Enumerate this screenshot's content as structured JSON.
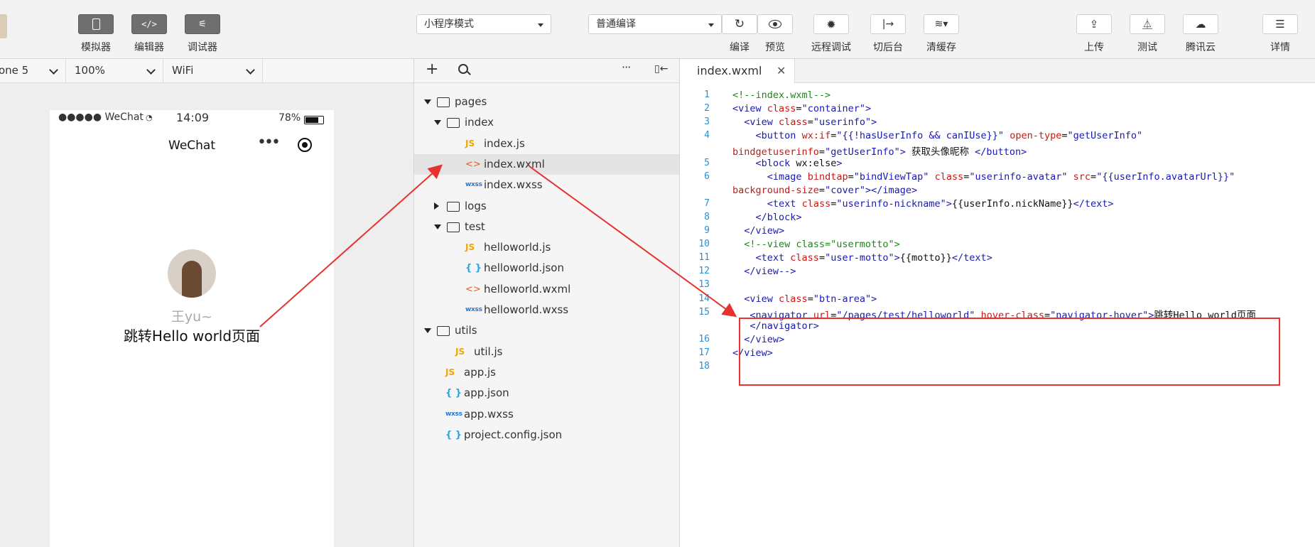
{
  "toolbar": {
    "left_buttons": [
      {
        "label": "模拟器"
      },
      {
        "label": "编辑器"
      },
      {
        "label": "调试器"
      }
    ],
    "mode_select": "小程序模式",
    "compile_select": "普通编译",
    "actions": [
      {
        "label": "编译"
      },
      {
        "label": "预览"
      },
      {
        "label": "远程调试"
      },
      {
        "label": "切后台"
      },
      {
        "label": "清缓存"
      }
    ],
    "right_actions": [
      {
        "label": "上传"
      },
      {
        "label": "测试"
      },
      {
        "label": "腾讯云"
      },
      {
        "label": "详情"
      }
    ]
  },
  "simulator": {
    "device": "one 5",
    "zoom": "100%",
    "network": "WiFi",
    "status": {
      "carrier": "●●●●● WeChat",
      "time": "14:09",
      "battery": "78%"
    },
    "nav_title": "WeChat",
    "nickname": "王yu~",
    "link_text": "跳转Hello world页面"
  },
  "file_tree": {
    "rows": [
      {
        "name": "pages",
        "type": "folder",
        "open": true
      },
      {
        "name": "index",
        "type": "folder",
        "open": true
      },
      {
        "name": "index.js",
        "type": "js"
      },
      {
        "name": "index.wxml",
        "type": "wxml",
        "selected": true
      },
      {
        "name": "index.wxss",
        "type": "wxss"
      },
      {
        "name": "logs",
        "type": "folder",
        "open": false
      },
      {
        "name": "test",
        "type": "folder",
        "open": true
      },
      {
        "name": "helloworld.js",
        "type": "js"
      },
      {
        "name": "helloworld.json",
        "type": "json"
      },
      {
        "name": "helloworld.wxml",
        "type": "wxml"
      },
      {
        "name": "helloworld.wxss",
        "type": "wxss"
      },
      {
        "name": "utils",
        "type": "folder",
        "open": true
      },
      {
        "name": "util.js",
        "type": "js"
      },
      {
        "name": "app.js",
        "type": "js"
      },
      {
        "name": "app.json",
        "type": "json"
      },
      {
        "name": "app.wxss",
        "type": "wxss"
      },
      {
        "name": "project.config.json",
        "type": "json"
      }
    ],
    "icon_text": {
      "js": "JS",
      "wxml": "<>",
      "wxss": "wxss",
      "json": "{ }"
    }
  },
  "editor": {
    "tab_name": "index.wxml",
    "line_numbers": [
      "1",
      "2",
      "3",
      "4",
      "5",
      "6",
      "7",
      "8",
      "9",
      "10",
      "11",
      "12",
      "13",
      "14",
      "15",
      "16",
      "17",
      "18"
    ],
    "lines": [
      "<!--index.wxml-->",
      "<view class=\"container\">",
      "  <view class=\"userinfo\">",
      "    <button wx:if=\"{{!hasUserInfo && canIUse}}\" open-type=\"getUserInfo\"",
      "bindgetuserinfo=\"getUserInfo\"> 获取头像昵称 </button>",
      "    <block wx:else>",
      "      <image bindtap=\"bindViewTap\" class=\"userinfo-avatar\" src=\"{{userInfo.avatarUrl}}\"",
      "background-size=\"cover\"></image>",
      "      <text class=\"userinfo-nickname\">{{userInfo.nickName}}</text>",
      "    </block>",
      "  </view>",
      "  <!--view class=\"usermotto\">",
      "    <text class=\"user-motto\">{{motto}}</text>",
      "  </view-->",
      "",
      "  <view class=\"btn-area\">",
      "   <navigator url=\"/pages/test/helloworld\" hover-class=\"navigator-hover\">跳转Hello world页面",
      "   </navigator>",
      "  </view>",
      "</view>",
      ""
    ]
  },
  "colors": {
    "highlight": "#e8322e",
    "accent_blue": "#2b73d5"
  }
}
